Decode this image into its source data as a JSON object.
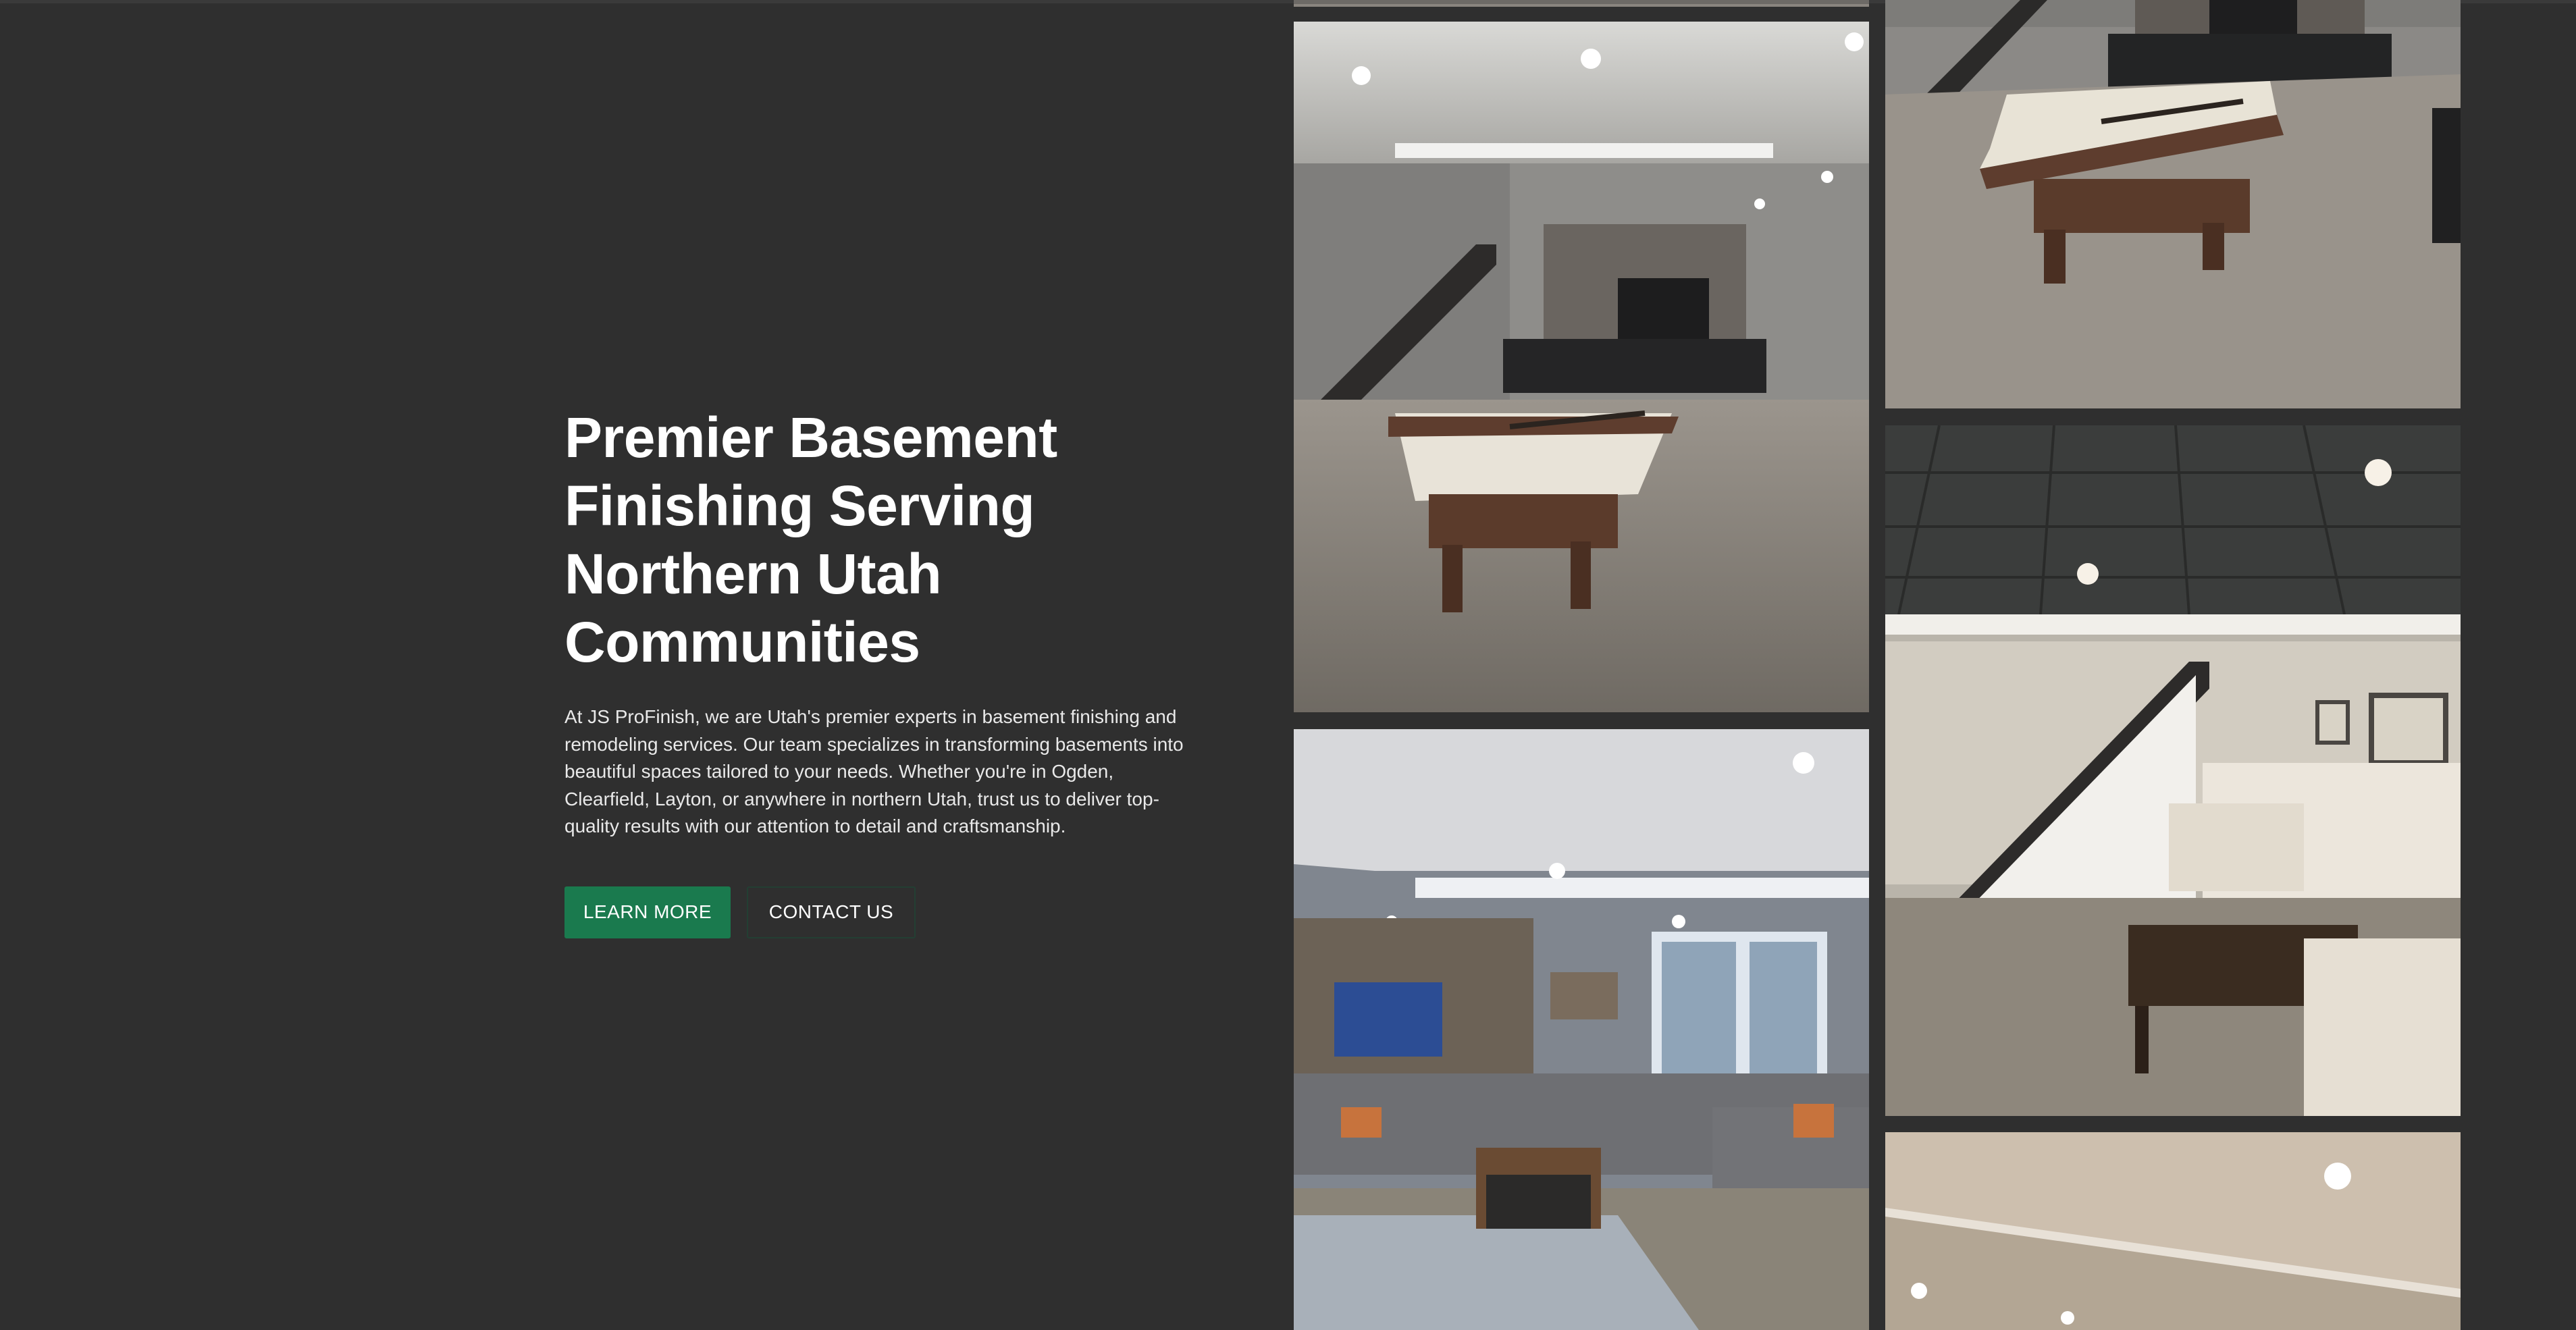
{
  "hero": {
    "title_lines": [
      "Premier Basement",
      "Finishing Serving",
      "Northern Utah",
      "Communities"
    ],
    "description_lines": [
      "At JS ProFinish, we are Utah's premier experts in basement finishing and",
      "remodeling services. Our team specializes in transforming basements into",
      "beautiful spaces tailored to your needs. Whether you're in Ogden,",
      "Clearfield, Layton, or anywhere in northern Utah, trust us to deliver top-",
      "quality results with our attention to detail and craftsmanship."
    ],
    "buttons": {
      "learn_more": "LEARN MORE",
      "contact_us": "CONTACT US"
    }
  },
  "colors": {
    "background": "#2f2f2f",
    "primary_button": "#1a7a4e",
    "secondary_button_border": "#233f33",
    "text": "#ffffff"
  },
  "gallery": {
    "images": [
      "basement-billiards-stone-wall-photo",
      "basement-billiards-sectional-photo",
      "basement-stairs-living-room-photo",
      "basement-sectional-wood-wall-photo",
      "basement-ceiling-lights-photo"
    ]
  }
}
